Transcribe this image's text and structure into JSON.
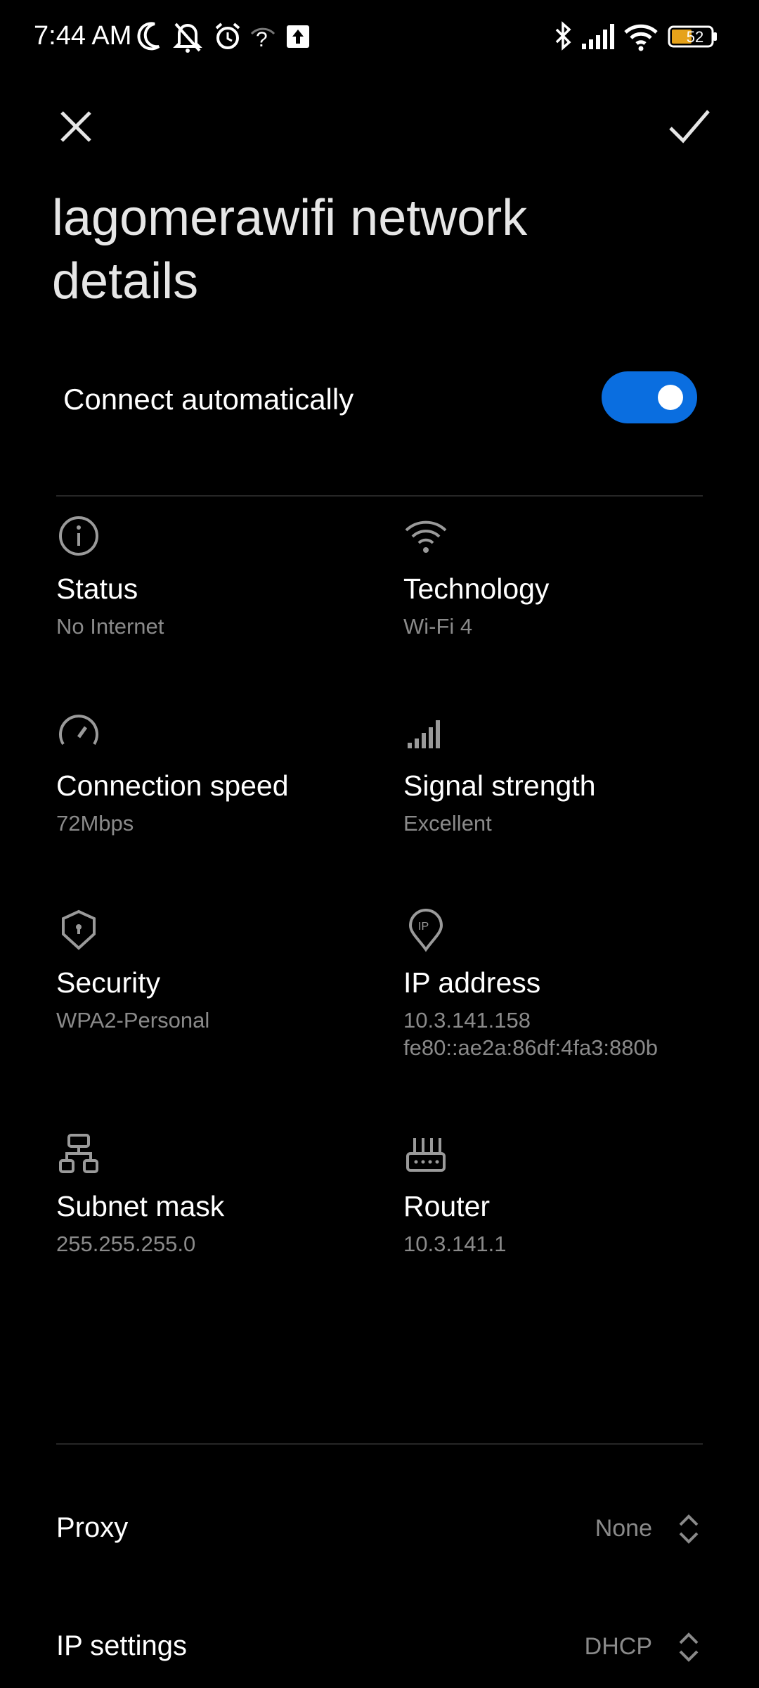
{
  "status_bar": {
    "time": "7:44 AM",
    "battery": "52",
    "icons": [
      "moon-icon",
      "notifications-off-icon",
      "alarm-icon",
      "wifi-question-icon",
      "upload-icon",
      "bluetooth-icon",
      "cellular-signal-icon",
      "wifi-icon",
      "battery-icon"
    ]
  },
  "header": {
    "close_icon": "close-icon",
    "confirm_icon": "check-icon",
    "title": "lagomerawifi network details"
  },
  "connect_automatically": {
    "label": "Connect automatically",
    "enabled": true,
    "accent_color": "#0a6ee0"
  },
  "details": [
    {
      "icon": "info-icon",
      "label": "Status",
      "value": "No Internet"
    },
    {
      "icon": "wifi-icon",
      "label": "Technology",
      "value": "Wi-Fi 4"
    },
    {
      "icon": "speedometer-icon",
      "label": "Connection speed",
      "value": "72Mbps"
    },
    {
      "icon": "signal-bars-icon",
      "label": "Signal strength",
      "value": "Excellent"
    },
    {
      "icon": "shield-icon",
      "label": "Security",
      "value": "WPA2-Personal"
    },
    {
      "icon": "ip-pin-icon",
      "label": "IP address",
      "value": "10.3.141.158",
      "value2": "fe80::ae2a:86df:4fa3:880b"
    },
    {
      "icon": "network-tree-icon",
      "label": "Subnet mask",
      "value": "255.255.255.0"
    },
    {
      "icon": "router-icon",
      "label": "Router",
      "value": "10.3.141.1"
    }
  ],
  "settings": [
    {
      "label": "Proxy",
      "value": "None"
    },
    {
      "label": "IP settings",
      "value": "DHCP"
    }
  ]
}
